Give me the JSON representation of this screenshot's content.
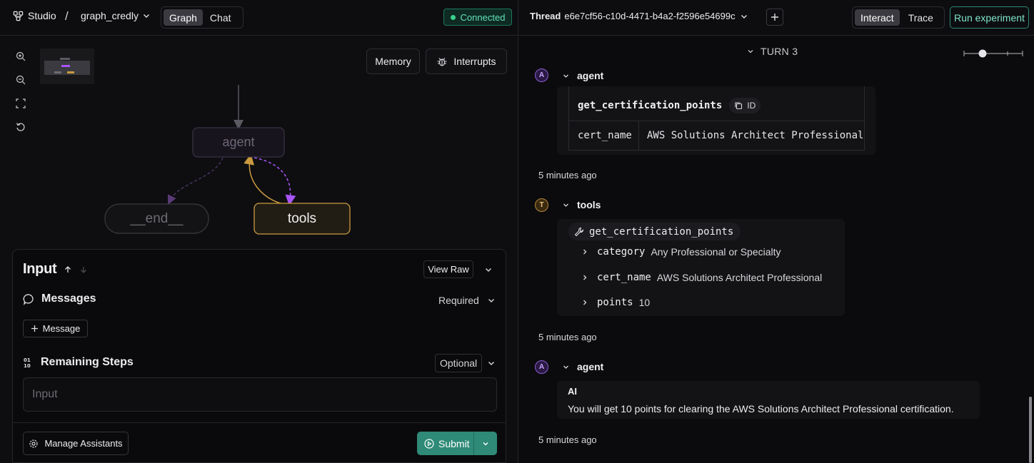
{
  "topbar": {
    "studio_label": "Studio",
    "separator": "/",
    "graph_name": "graph_credly",
    "view_tabs": [
      "Graph",
      "Chat"
    ],
    "active_view": "Graph",
    "status": "Connected",
    "thread_label": "Thread",
    "thread_id": "e6e7cf56-c10d-4471-b4a2-f2596e54699c",
    "mode_tabs": [
      "Interact",
      "Trace"
    ],
    "active_mode": "Interact",
    "run_experiment": "Run experiment"
  },
  "graph": {
    "memory_button": "Memory",
    "interrupts_button": "Interrupts",
    "nodes": {
      "agent": "agent",
      "end": "__end__",
      "tools": "tools"
    }
  },
  "input_panel": {
    "title": "Input",
    "view_raw": "View Raw",
    "messages": {
      "label": "Messages",
      "requirement": "Required",
      "add_button": "Message"
    },
    "remaining_steps": {
      "label": "Remaining Steps",
      "requirement": "Optional",
      "placeholder": "Input"
    },
    "manage_assistants": "Manage Assistants",
    "submit": "Submit"
  },
  "thread_view": {
    "turn_label": "TURN 3",
    "entries": {
      "agent1": {
        "badge": "A",
        "name": "agent",
        "tool_call": {
          "name": "get_certification_points",
          "id_label": "ID",
          "arg_key": "cert_name",
          "arg_value": "AWS Solutions Architect Professional"
        },
        "time": "5 minutes ago"
      },
      "tools": {
        "badge": "T",
        "name": "tools",
        "function": "get_certification_points",
        "results": [
          {
            "key": "category",
            "value": "Any Professional or Specialty"
          },
          {
            "key": "cert_name",
            "value": "AWS Solutions Architect Professional"
          },
          {
            "key": "points",
            "value": "10"
          }
        ],
        "time": "5 minutes ago"
      },
      "agent2": {
        "badge": "A",
        "name": "agent",
        "role": "AI",
        "message": "You will get 10 points for clearing the AWS Solutions Architect Professional certification.",
        "time": "5 minutes ago"
      }
    }
  },
  "colors": {
    "accent_green": "#2f8a78",
    "connected": "#63e2b7",
    "agent_badge": "#8b5cd6",
    "tools_badge": "#b8873a",
    "tools_node_border": "#c99a3e"
  }
}
